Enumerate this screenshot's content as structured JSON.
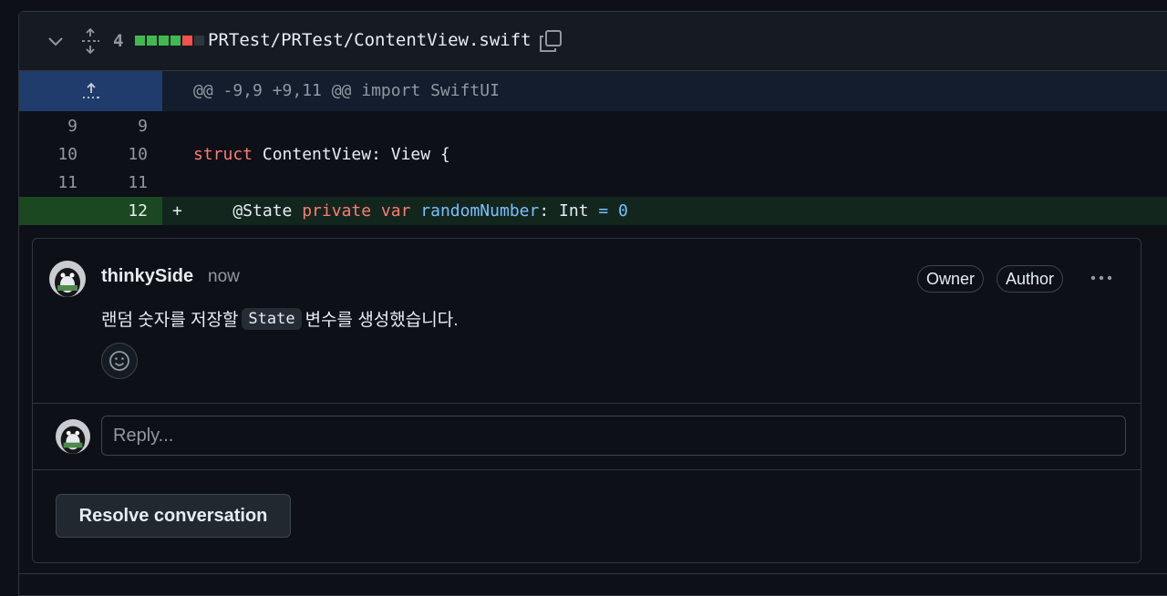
{
  "file": {
    "changes_count": "4",
    "diffstat": [
      "#3fb950",
      "#3fb950",
      "#3fb950",
      "#3fb950",
      "#f85149",
      "#30363d"
    ],
    "path": "PRTest/PRTest/ContentView.swift",
    "hunk_header": "@@ -9,9 +9,11 @@ import SwiftUI"
  },
  "lines": [
    {
      "old": "9",
      "new": "9",
      "type": "context"
    },
    {
      "old": "10",
      "new": "10",
      "type": "context",
      "tokens": [
        {
          "t": "struct",
          "c": "kw"
        },
        {
          "t": " ContentView: View {",
          "c": "ty"
        }
      ]
    },
    {
      "old": "11",
      "new": "11",
      "type": "context"
    },
    {
      "old": "",
      "new": "12",
      "type": "add",
      "marker": "+",
      "tokens": [
        {
          "t": "    @State ",
          "c": "ty"
        },
        {
          "t": "private",
          "c": "kw"
        },
        {
          "t": " ",
          "c": "ty"
        },
        {
          "t": "var",
          "c": "kw"
        },
        {
          "t": " ",
          "c": "ty"
        },
        {
          "t": "randomNumber",
          "c": "vn"
        },
        {
          "t": ": Int ",
          "c": "ty"
        },
        {
          "t": "=",
          "c": "vn"
        },
        {
          "t": " ",
          "c": "ty"
        },
        {
          "t": "0",
          "c": "vn"
        }
      ]
    }
  ],
  "comment": {
    "author": "thinkySide",
    "time": "now",
    "badges": [
      "Owner",
      "Author"
    ],
    "body_before": "랜덤 숫자를 저장할",
    "body_code": "State",
    "body_after": "변수를 생성했습니다."
  },
  "reply": {
    "placeholder": "Reply..."
  },
  "actions": {
    "resolve_label": "Resolve conversation"
  },
  "colors": {
    "accent_add": "#1b4721",
    "hunk": "#1f3c6c",
    "bg": "#0d1117"
  }
}
